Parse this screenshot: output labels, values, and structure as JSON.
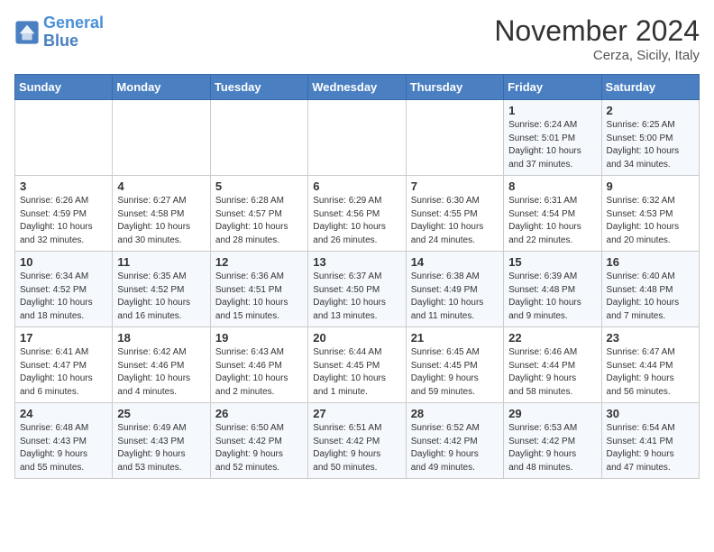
{
  "header": {
    "logo_line1": "General",
    "logo_line2": "Blue",
    "month": "November 2024",
    "location": "Cerza, Sicily, Italy"
  },
  "days_of_week": [
    "Sunday",
    "Monday",
    "Tuesday",
    "Wednesday",
    "Thursday",
    "Friday",
    "Saturday"
  ],
  "weeks": [
    [
      {
        "day": "",
        "info": ""
      },
      {
        "day": "",
        "info": ""
      },
      {
        "day": "",
        "info": ""
      },
      {
        "day": "",
        "info": ""
      },
      {
        "day": "",
        "info": ""
      },
      {
        "day": "1",
        "info": "Sunrise: 6:24 AM\nSunset: 5:01 PM\nDaylight: 10 hours\nand 37 minutes."
      },
      {
        "day": "2",
        "info": "Sunrise: 6:25 AM\nSunset: 5:00 PM\nDaylight: 10 hours\nand 34 minutes."
      }
    ],
    [
      {
        "day": "3",
        "info": "Sunrise: 6:26 AM\nSunset: 4:59 PM\nDaylight: 10 hours\nand 32 minutes."
      },
      {
        "day": "4",
        "info": "Sunrise: 6:27 AM\nSunset: 4:58 PM\nDaylight: 10 hours\nand 30 minutes."
      },
      {
        "day": "5",
        "info": "Sunrise: 6:28 AM\nSunset: 4:57 PM\nDaylight: 10 hours\nand 28 minutes."
      },
      {
        "day": "6",
        "info": "Sunrise: 6:29 AM\nSunset: 4:56 PM\nDaylight: 10 hours\nand 26 minutes."
      },
      {
        "day": "7",
        "info": "Sunrise: 6:30 AM\nSunset: 4:55 PM\nDaylight: 10 hours\nand 24 minutes."
      },
      {
        "day": "8",
        "info": "Sunrise: 6:31 AM\nSunset: 4:54 PM\nDaylight: 10 hours\nand 22 minutes."
      },
      {
        "day": "9",
        "info": "Sunrise: 6:32 AM\nSunset: 4:53 PM\nDaylight: 10 hours\nand 20 minutes."
      }
    ],
    [
      {
        "day": "10",
        "info": "Sunrise: 6:34 AM\nSunset: 4:52 PM\nDaylight: 10 hours\nand 18 minutes."
      },
      {
        "day": "11",
        "info": "Sunrise: 6:35 AM\nSunset: 4:52 PM\nDaylight: 10 hours\nand 16 minutes."
      },
      {
        "day": "12",
        "info": "Sunrise: 6:36 AM\nSunset: 4:51 PM\nDaylight: 10 hours\nand 15 minutes."
      },
      {
        "day": "13",
        "info": "Sunrise: 6:37 AM\nSunset: 4:50 PM\nDaylight: 10 hours\nand 13 minutes."
      },
      {
        "day": "14",
        "info": "Sunrise: 6:38 AM\nSunset: 4:49 PM\nDaylight: 10 hours\nand 11 minutes."
      },
      {
        "day": "15",
        "info": "Sunrise: 6:39 AM\nSunset: 4:48 PM\nDaylight: 10 hours\nand 9 minutes."
      },
      {
        "day": "16",
        "info": "Sunrise: 6:40 AM\nSunset: 4:48 PM\nDaylight: 10 hours\nand 7 minutes."
      }
    ],
    [
      {
        "day": "17",
        "info": "Sunrise: 6:41 AM\nSunset: 4:47 PM\nDaylight: 10 hours\nand 6 minutes."
      },
      {
        "day": "18",
        "info": "Sunrise: 6:42 AM\nSunset: 4:46 PM\nDaylight: 10 hours\nand 4 minutes."
      },
      {
        "day": "19",
        "info": "Sunrise: 6:43 AM\nSunset: 4:46 PM\nDaylight: 10 hours\nand 2 minutes."
      },
      {
        "day": "20",
        "info": "Sunrise: 6:44 AM\nSunset: 4:45 PM\nDaylight: 10 hours\nand 1 minute."
      },
      {
        "day": "21",
        "info": "Sunrise: 6:45 AM\nSunset: 4:45 PM\nDaylight: 9 hours\nand 59 minutes."
      },
      {
        "day": "22",
        "info": "Sunrise: 6:46 AM\nSunset: 4:44 PM\nDaylight: 9 hours\nand 58 minutes."
      },
      {
        "day": "23",
        "info": "Sunrise: 6:47 AM\nSunset: 4:44 PM\nDaylight: 9 hours\nand 56 minutes."
      }
    ],
    [
      {
        "day": "24",
        "info": "Sunrise: 6:48 AM\nSunset: 4:43 PM\nDaylight: 9 hours\nand 55 minutes."
      },
      {
        "day": "25",
        "info": "Sunrise: 6:49 AM\nSunset: 4:43 PM\nDaylight: 9 hours\nand 53 minutes."
      },
      {
        "day": "26",
        "info": "Sunrise: 6:50 AM\nSunset: 4:42 PM\nDaylight: 9 hours\nand 52 minutes."
      },
      {
        "day": "27",
        "info": "Sunrise: 6:51 AM\nSunset: 4:42 PM\nDaylight: 9 hours\nand 50 minutes."
      },
      {
        "day": "28",
        "info": "Sunrise: 6:52 AM\nSunset: 4:42 PM\nDaylight: 9 hours\nand 49 minutes."
      },
      {
        "day": "29",
        "info": "Sunrise: 6:53 AM\nSunset: 4:42 PM\nDaylight: 9 hours\nand 48 minutes."
      },
      {
        "day": "30",
        "info": "Sunrise: 6:54 AM\nSunset: 4:41 PM\nDaylight: 9 hours\nand 47 minutes."
      }
    ]
  ]
}
